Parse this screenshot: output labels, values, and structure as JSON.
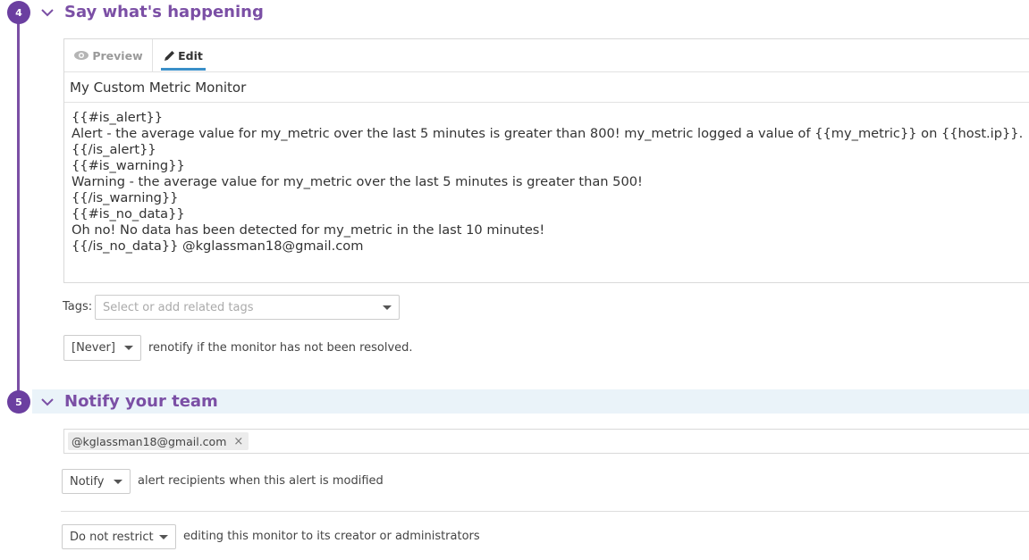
{
  "step4": {
    "number": "4",
    "title": "Say what's happening",
    "tabs": {
      "preview": "Preview",
      "edit": "Edit"
    },
    "message_title": "My Custom Metric Monitor",
    "message_body": [
      "{{#is_alert}}",
      "Alert - the average value for my_metric over the last 5 minutes is greater than 800! my_metric logged a value of {{my_metric}} on {{host.ip}}.",
      "{{/is_alert}}",
      "{{#is_warning}}",
      "Warning - the average value for my_metric over the last 5 minutes is greater than 500!",
      "{{/is_warning}}",
      "{{#is_no_data}}",
      "Oh no! No data has been detected for my_metric in the last 10 minutes!",
      "{{/is_no_data}}  @kglassman18@gmail.com"
    ],
    "tags_label": "Tags:",
    "tags_placeholder": "Select or add related tags",
    "renotify_value": "[Never]",
    "renotify_text": "renotify if the monitor has not been resolved."
  },
  "step5": {
    "number": "5",
    "title": "Notify your team",
    "recipient": "@kglassman18@gmail.com",
    "recipient_remove": "×",
    "notify_value": "Notify",
    "notify_text": "alert recipients when this alert is modified",
    "restrict_value": "Do not restrict",
    "restrict_text": "editing this monitor to its creator or administrators"
  },
  "colors": {
    "accent_purple": "#7b4fa5",
    "tab_underline": "#3a8fc8",
    "section_band": "#eaf3f9"
  },
  "icons": [
    "chevron-down-icon",
    "eye-icon",
    "pencil-icon",
    "dropdown-caret-icon",
    "close-icon"
  ]
}
